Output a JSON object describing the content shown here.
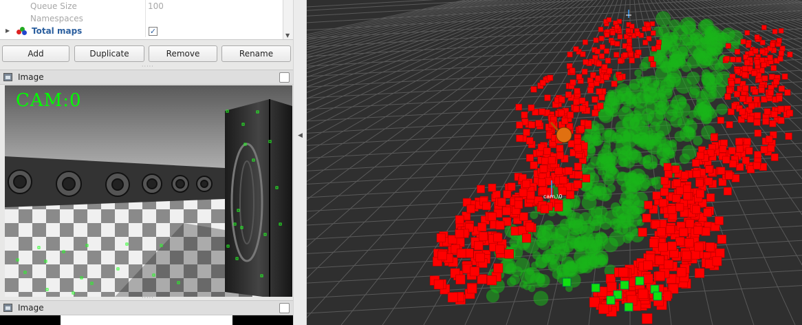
{
  "properties": {
    "rows": [
      {
        "name": "Queue Size",
        "value": "100"
      },
      {
        "name": "Namespaces",
        "value": ""
      }
    ],
    "total_maps": {
      "name": "Total maps",
      "checked_glyph": "✓"
    }
  },
  "buttons": {
    "add": "Add",
    "duplicate": "Duplicate",
    "remove": "Remove",
    "rename": "Rename"
  },
  "image_panel_1": {
    "title": "Image",
    "cam_label": "CAM:0"
  },
  "image_panel_2": {
    "title": "Image"
  },
  "view3d": {
    "camera_label": "cam,\\0",
    "colors": {
      "occupied": "#ff0000",
      "free": "#19b419",
      "grid": "#5a5a5a",
      "background": "#2f2f2f"
    }
  },
  "icons": {
    "expand": "triangle-right-icon",
    "collapse": "triangle-left-icon",
    "scroll_down": "triangle-down-icon",
    "display_type": "rgb-balls-icon",
    "panel": "image-panel-icon"
  }
}
